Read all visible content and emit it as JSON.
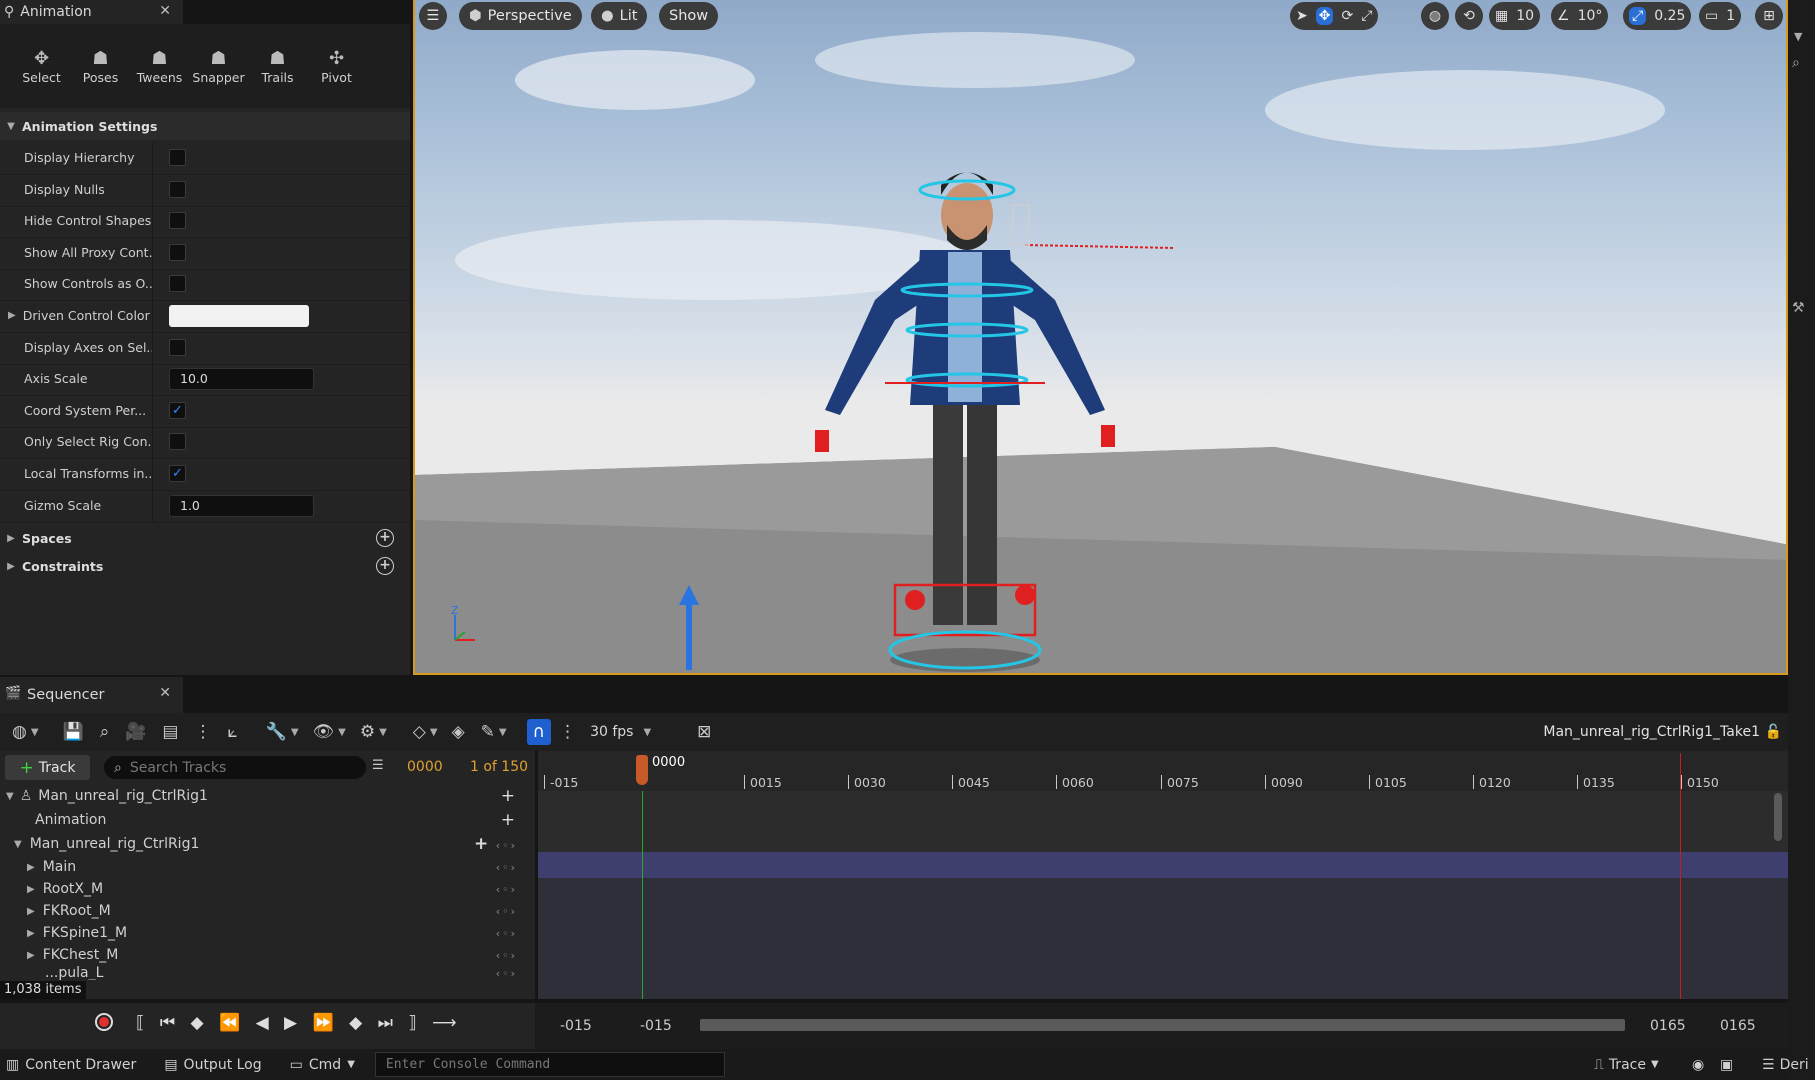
{
  "animation_panel": {
    "tab_title": "Animation",
    "modes": [
      {
        "label": "Select",
        "icon": "select-icon"
      },
      {
        "label": "Poses",
        "icon": "poses-icon"
      },
      {
        "label": "Tweens",
        "icon": "tweens-icon"
      },
      {
        "label": "Snapper",
        "icon": "snapper-icon"
      },
      {
        "label": "Trails",
        "icon": "trails-icon"
      },
      {
        "label": "Pivot",
        "icon": "pivot-icon"
      }
    ],
    "section_title": "Animation Settings",
    "props": [
      {
        "label": "Display Hierarchy",
        "checked": false
      },
      {
        "label": "Display Nulls",
        "checked": false
      },
      {
        "label": "Hide Control Shapes",
        "checked": false
      },
      {
        "label": "Show All Proxy Cont...",
        "checked": false
      },
      {
        "label": "Show Controls as O...",
        "checked": false
      },
      {
        "label": "Driven Control Color",
        "color": "#f2f2f2"
      },
      {
        "label": "Display Axes on Sel...",
        "checked": false
      },
      {
        "label": "Axis Scale",
        "value": "10.0"
      },
      {
        "label": "Coord System Per...",
        "checked": true
      },
      {
        "label": "Only Select Rig Con...",
        "checked": false
      },
      {
        "label": "Local Transforms in...",
        "checked": true
      },
      {
        "label": "Gizmo Scale",
        "value": "1.0"
      }
    ],
    "spaces_label": "Spaces",
    "constraints_label": "Constraints"
  },
  "viewport": {
    "perspective": "Perspective",
    "lit": "Lit",
    "show": "Show",
    "grid_value": "10",
    "angle_value": "10°",
    "scale_value": "0.25",
    "camera_speed": "1",
    "accent": "#2a6fd6",
    "border_color": "#d89a18"
  },
  "sequencer": {
    "tab_title": "Sequencer",
    "fps": "30 fps",
    "sequence_name": "Man_unreal_rig_CtrlRig1_Take1",
    "add_track": "Track",
    "search_placeholder": "Search Tracks",
    "current_frame": "0000",
    "frame_of": "1 of 150",
    "playhead_label": "0000",
    "tracks": [
      {
        "label": "Man_unreal_rig_CtrlRig1",
        "level": 0
      },
      {
        "label": "Animation",
        "level": 1
      },
      {
        "label": "Man_unreal_rig_CtrlRig1",
        "level": 1
      },
      {
        "label": "Main",
        "level": 2
      },
      {
        "label": "RootX_M",
        "level": 2
      },
      {
        "label": "FKRoot_M",
        "level": 2
      },
      {
        "label": "FKSpine1_M",
        "level": 2
      },
      {
        "label": "FKChest_M",
        "level": 2
      },
      {
        "label": "...pula_L",
        "level": 2
      }
    ],
    "items_count": "1,038 items",
    "ruler": [
      "-015",
      "0015",
      "0030",
      "0045",
      "0060",
      "0075",
      "0090",
      "0105",
      "0120",
      "0135",
      "0150"
    ],
    "range_start_a": "-015",
    "range_start_b": "-015",
    "range_end_a": "0165",
    "range_end_b": "0165"
  },
  "status_bar": {
    "content_drawer": "Content Drawer",
    "output_log": "Output Log",
    "cmd": "Cmd",
    "console_placeholder": "Enter Console Command",
    "trace": "Trace",
    "deri": "Deri"
  }
}
